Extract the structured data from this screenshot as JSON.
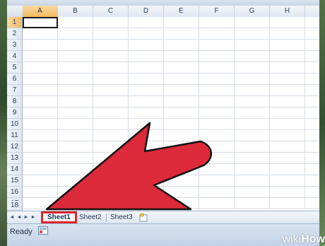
{
  "spreadsheet": {
    "columns": [
      "A",
      "B",
      "C",
      "D",
      "E",
      "F",
      "G",
      "H"
    ],
    "rows": [
      "1",
      "2",
      "3",
      "4",
      "5",
      "6",
      "7",
      "8",
      "9",
      "10",
      "11",
      "12",
      "13",
      "14",
      "15",
      "16",
      "17",
      "18"
    ],
    "active_cell": "A1"
  },
  "sheet_tabs": [
    {
      "label": "Sheet1",
      "active": true
    },
    {
      "label": "Sheet2",
      "active": false
    },
    {
      "label": "Sheet3",
      "active": false
    }
  ],
  "status_bar": {
    "status": "Ready"
  },
  "watermark": {
    "wiki": "wiki",
    "how": "How"
  },
  "colors": {
    "highlight_border": "#e0242e",
    "arrow_fill": "#dc2a3b",
    "header_active": "#f1b962"
  },
  "icons": {
    "nav": [
      "first-sheet-icon",
      "prev-sheet-icon",
      "next-sheet-icon",
      "last-sheet-icon"
    ],
    "insert_sheet": "insert-sheet-icon",
    "macro": "macro-record-icon",
    "arrow": "pointer-arrow-icon"
  }
}
